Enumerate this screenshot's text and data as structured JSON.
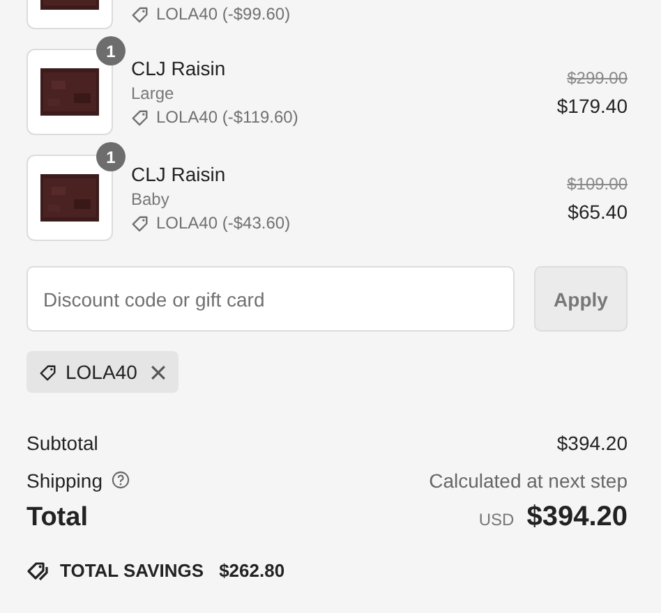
{
  "line_items": [
    {
      "discount": "LOLA40 (-$99.60)"
    },
    {
      "quantity": "1",
      "name": "CLJ Raisin",
      "variant": "Large",
      "discount": "LOLA40 (-$119.60)",
      "original_price": "$299.00",
      "price": "$179.40"
    },
    {
      "quantity": "1",
      "name": "CLJ Raisin",
      "variant": "Baby",
      "discount": "LOLA40 (-$43.60)",
      "original_price": "$109.00",
      "price": "$65.40"
    }
  ],
  "discount_field": {
    "placeholder": "Discount code or gift card"
  },
  "apply_button": "Apply",
  "applied_codes": [
    {
      "code": "LOLA40"
    }
  ],
  "summary": {
    "subtotal_label": "Subtotal",
    "subtotal": "$394.20",
    "shipping_label": "Shipping",
    "shipping": "Calculated at next step",
    "total_label": "Total",
    "currency": "USD",
    "total": "$394.20",
    "savings_label": "TOTAL SAVINGS",
    "savings": "$262.80"
  }
}
